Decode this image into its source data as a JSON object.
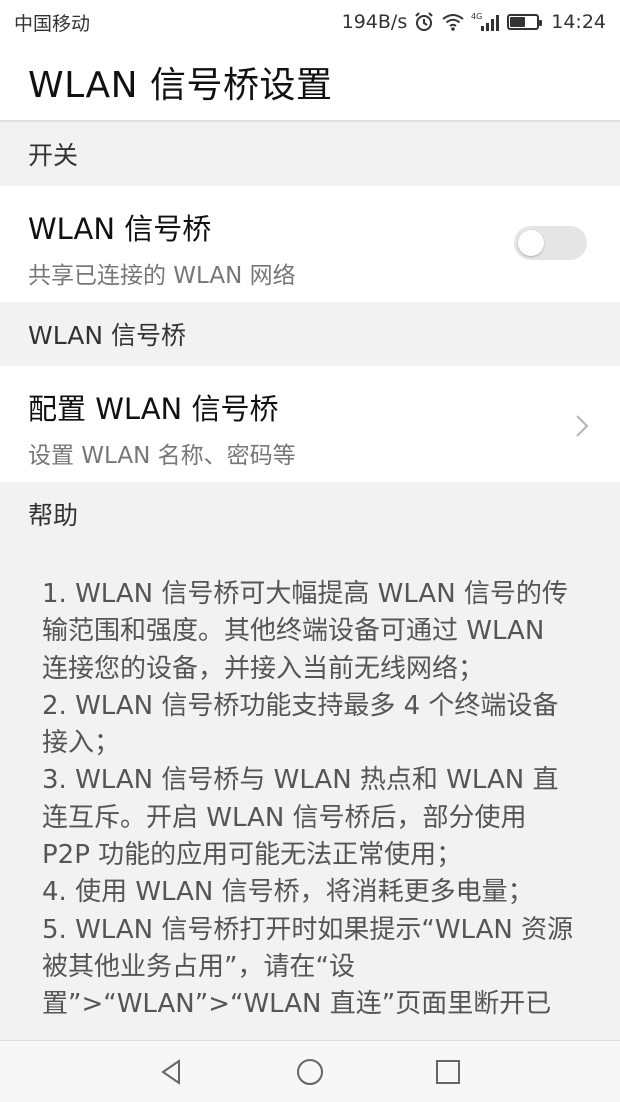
{
  "status_bar": {
    "carrier": "中国移动",
    "speed": "194B/s",
    "time": "14:24",
    "network_label": "4G",
    "icons": [
      "alarm-icon",
      "wifi-icon",
      "signal-icon",
      "battery-icon"
    ]
  },
  "app_bar": {
    "title": "WLAN 信号桥设置"
  },
  "sections": {
    "switch": {
      "header": "开关",
      "row_title": "WLAN 信号桥",
      "row_subtitle": "共享已连接的 WLAN 网络",
      "toggle_on": false
    },
    "bridge": {
      "header": "WLAN 信号桥",
      "row_title": "配置 WLAN 信号桥",
      "row_subtitle": "设置 WLAN 名称、密码等"
    },
    "help": {
      "header": "帮助",
      "items": [
        "1. WLAN 信号桥可大幅提高 WLAN 信号的传输范围和强度。其他终端设备可通过 WLAN 连接您的设备，并接入当前无线网络；",
        "2. WLAN 信号桥功能支持最多 4 个终端设备接入；",
        "3. WLAN 信号桥与 WLAN 热点和 WLAN 直连互斥。开启 WLAN 信号桥后，部分使用 P2P 功能的应用可能无法正常使用；",
        "4. 使用 WLAN 信号桥，将消耗更多电量；",
        "5. WLAN 信号桥打开时如果提示“WLAN 资源被其他业务占用”，请在“设置”>“WLAN”>“WLAN 直连”页面里断开已"
      ]
    }
  },
  "nav_bar": {
    "buttons": [
      "back-icon",
      "home-icon",
      "recents-icon"
    ]
  },
  "colors": {
    "background": "#f2f2f2",
    "surface": "#ffffff",
    "toggle_off": "#e5e5e5",
    "text_primary": "#111111",
    "text_secondary": "#777777"
  }
}
